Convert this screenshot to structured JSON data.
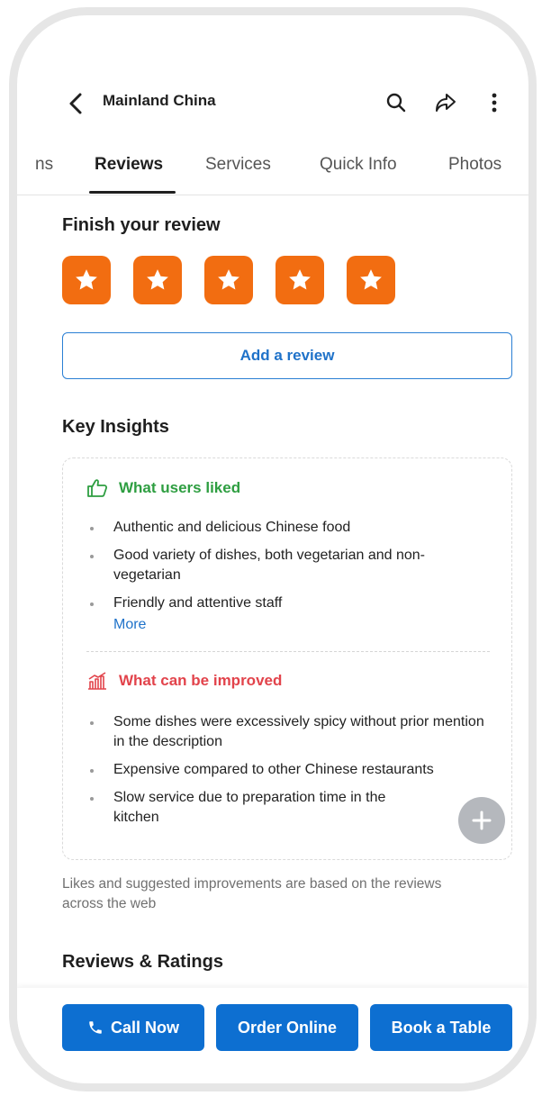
{
  "header": {
    "title": "Mainland China",
    "icons": [
      "back-arrow-icon",
      "search-icon",
      "share-icon",
      "more-vertical-icon"
    ]
  },
  "tabs": [
    {
      "label": "ns",
      "active": false
    },
    {
      "label": "Reviews",
      "active": true
    },
    {
      "label": "Services",
      "active": false
    },
    {
      "label": "Quick Info",
      "active": false
    },
    {
      "label": "Photos",
      "active": false
    }
  ],
  "review": {
    "title": "Finish your review",
    "stars_selected": 5,
    "stars_total": 5,
    "add_review_label": "Add a review",
    "star_color": "#f26d11"
  },
  "insights": {
    "title": "Key Insights",
    "liked": {
      "heading": "What users liked",
      "icon": "thumbs-up-icon",
      "color": "#2e9e41",
      "items": [
        "Authentic and delicious Chinese food",
        "Good variety of dishes, both vegetarian and non-vegetarian",
        "Friendly and attentive staff"
      ],
      "more_label": "More"
    },
    "improve": {
      "heading": "What can be improved",
      "icon": "chart-icon",
      "color": "#e2434b",
      "items": [
        "Some dishes were excessively spicy without prior mention in the description",
        "Expensive compared to other Chinese restaurants",
        "Slow service due to preparation time in the kitchen"
      ]
    },
    "disclaimer": "Likes and suggested improvements are based on the reviews across the web"
  },
  "ratings_section": {
    "title": "Reviews & Ratings"
  },
  "actions": {
    "call": "Call Now",
    "order": "Order Online",
    "book": "Book a Table",
    "accent": "#0d6fd1"
  }
}
